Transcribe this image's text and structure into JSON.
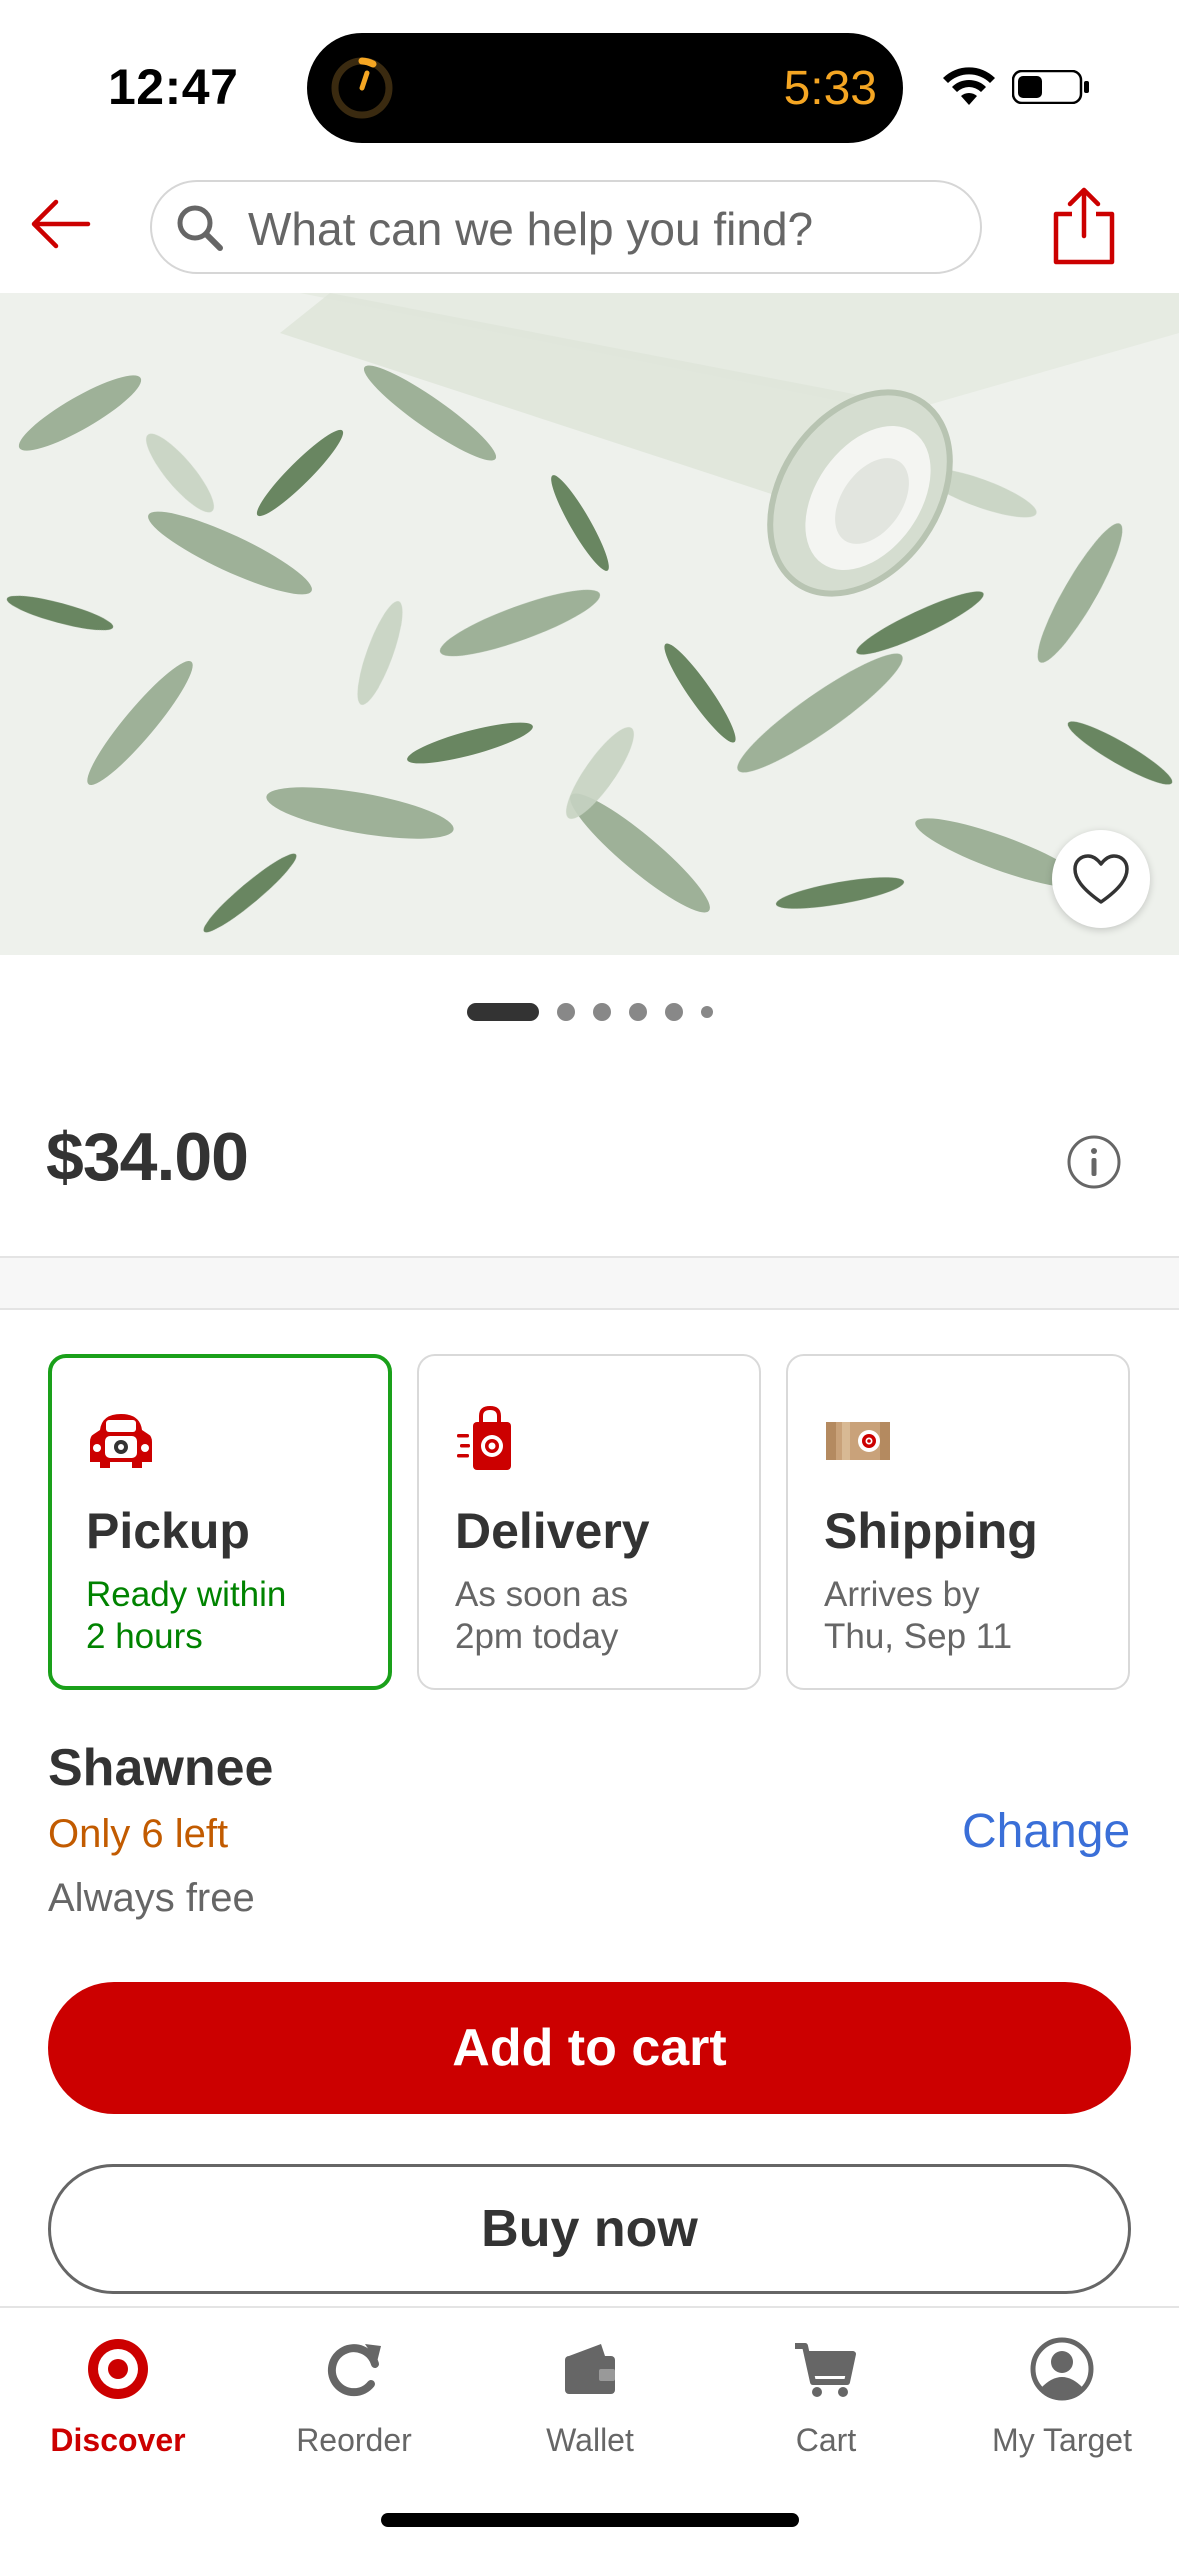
{
  "status_bar": {
    "time": "12:47",
    "timer": "5:33"
  },
  "header": {
    "search_placeholder": "What can we help you find?",
    "icons": [
      "back-arrow-icon",
      "search-icon",
      "share-icon"
    ]
  },
  "product": {
    "image_count": 6,
    "active_image_index": 0,
    "price": "$34.00"
  },
  "fulfillment": {
    "options": [
      {
        "title": "Pickup",
        "line1": "Ready within",
        "line2": "2 hours",
        "selected": true,
        "icon": "pickup-car-icon"
      },
      {
        "title": "Delivery",
        "line1": "As soon as",
        "line2": "2pm today",
        "selected": false,
        "icon": "delivery-bag-icon"
      },
      {
        "title": "Shipping",
        "line1": "Arrives by",
        "line2": "Thu, Sep 11",
        "selected": false,
        "icon": "shipping-box-icon"
      }
    ],
    "store": "Shawnee",
    "stock": "Only 6 left",
    "fee": "Always free",
    "change_label": "Change"
  },
  "actions": {
    "add_to_cart": "Add to cart",
    "buy_now": "Buy now"
  },
  "tabbar": {
    "items": [
      {
        "label": "Discover",
        "icon": "target-bullseye-icon",
        "active": true
      },
      {
        "label": "Reorder",
        "icon": "refresh-icon",
        "active": false
      },
      {
        "label": "Wallet",
        "icon": "wallet-icon",
        "active": false
      },
      {
        "label": "Cart",
        "icon": "cart-icon",
        "active": false
      },
      {
        "label": "My Target",
        "icon": "account-icon",
        "active": false
      }
    ]
  },
  "colors": {
    "brand_red": "#cc0000",
    "pickup_green": "#1aa01a",
    "stock_orange": "#c25b00",
    "link_blue": "#3a6fd8"
  }
}
